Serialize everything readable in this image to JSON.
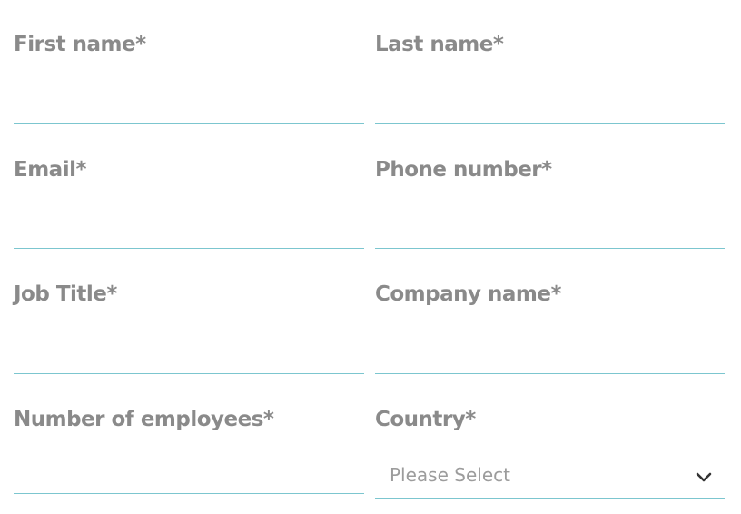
{
  "form": {
    "first_name": {
      "label": "First name*",
      "value": ""
    },
    "last_name": {
      "label": "Last name*",
      "value": ""
    },
    "email": {
      "label": "Email*",
      "value": ""
    },
    "phone": {
      "label": "Phone number*",
      "value": ""
    },
    "job_title": {
      "label": "Job Title*",
      "value": ""
    },
    "company": {
      "label": "Company name*",
      "value": ""
    },
    "employees": {
      "label": "Number of employees*",
      "value": ""
    },
    "country": {
      "label": "Country*",
      "selected": "Please Select"
    }
  },
  "colors": {
    "label": "#8a8a8a",
    "underline": "#7cc6cf",
    "placeholder": "#9c9c9c"
  },
  "icons": {
    "country_dropdown": "chevron-down-icon"
  }
}
